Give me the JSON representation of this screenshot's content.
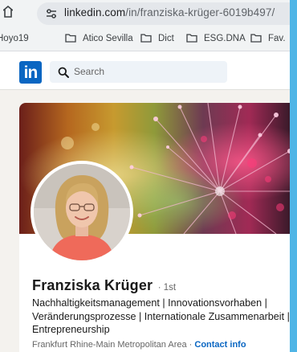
{
  "browser": {
    "url_host": "linkedin.com",
    "url_path": "/in/franziska-krüger-6019b497/"
  },
  "bookmarks": [
    {
      "label": "Hoyo19",
      "icon": "folder-icon"
    },
    {
      "label": "Atico Sevilla",
      "icon": "folder-icon"
    },
    {
      "label": "Dict",
      "icon": "folder-icon"
    },
    {
      "label": "ESG.DNA",
      "icon": "folder-icon"
    },
    {
      "label": "Fav.",
      "icon": "folder-icon"
    }
  ],
  "linkedin": {
    "logo_text": "in",
    "search_placeholder": "Search"
  },
  "profile": {
    "name": "Franziska Krüger",
    "degree": "· 1st",
    "headline": "Nachhaltigkeitsmanagement | Innovationsvorhaben | Veränderungsprozesse | Internationale Zusammenarbeit | Entrepreneurship",
    "location": "Frankfurt Rhine-Main Metropolitan Area",
    "separator": "·",
    "contact_label": "Contact info"
  },
  "colors": {
    "side_strip": "#4fb5e6",
    "brand_blue": "#0a66c2"
  }
}
